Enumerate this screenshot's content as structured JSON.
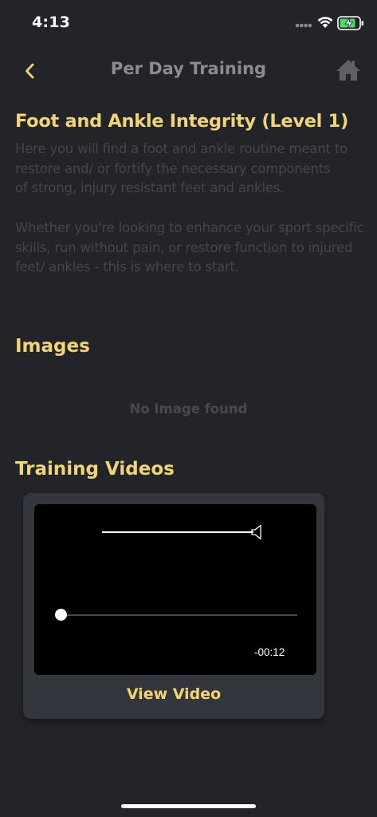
{
  "status_bar": {
    "time": "4:13"
  },
  "nav": {
    "title": "Per Day Training",
    "back_icon": "chevron-left-icon",
    "home_icon": "home-icon"
  },
  "program": {
    "title": "Foot and Ankle Integrity (Level 1)",
    "description": "Here you will find a foot and ankle routine meant to restore and/ or fortify the necessary components\n of strong, injury resistant feet and ankles.\n\nWhether you're looking to enhance your sport specific skills, run without pain, or restore function to injured feet/ ankles - this is where to start."
  },
  "images": {
    "title": "Images",
    "empty_text": "No Image found"
  },
  "videos": {
    "title": "Training Videos",
    "items": [
      {
        "time_remaining": "-00:12",
        "progress": 0,
        "volume": 1,
        "button_label": "View Video"
      }
    ]
  },
  "colors": {
    "background": "#222429",
    "accent": "#f2d472",
    "card": "#33363c",
    "muted_text": "#44464b"
  }
}
